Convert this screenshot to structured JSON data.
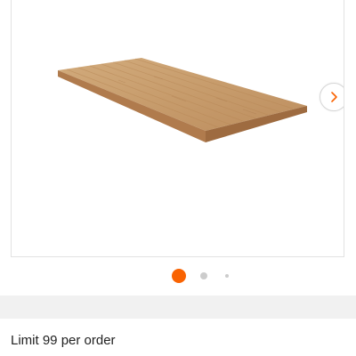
{
  "gallery": {
    "image_alt": "Butcher block countertop",
    "next_icon": "chevron-right-icon",
    "page_count": 3,
    "active_page": 1
  },
  "colors": {
    "accent": "#f96302",
    "dot_inactive": "#cccccc",
    "band": "#f1f1f1",
    "wood_top": "#c9a071",
    "wood_edge": "#a87448"
  },
  "purchase": {
    "limit_text": "Limit 99 per order"
  }
}
